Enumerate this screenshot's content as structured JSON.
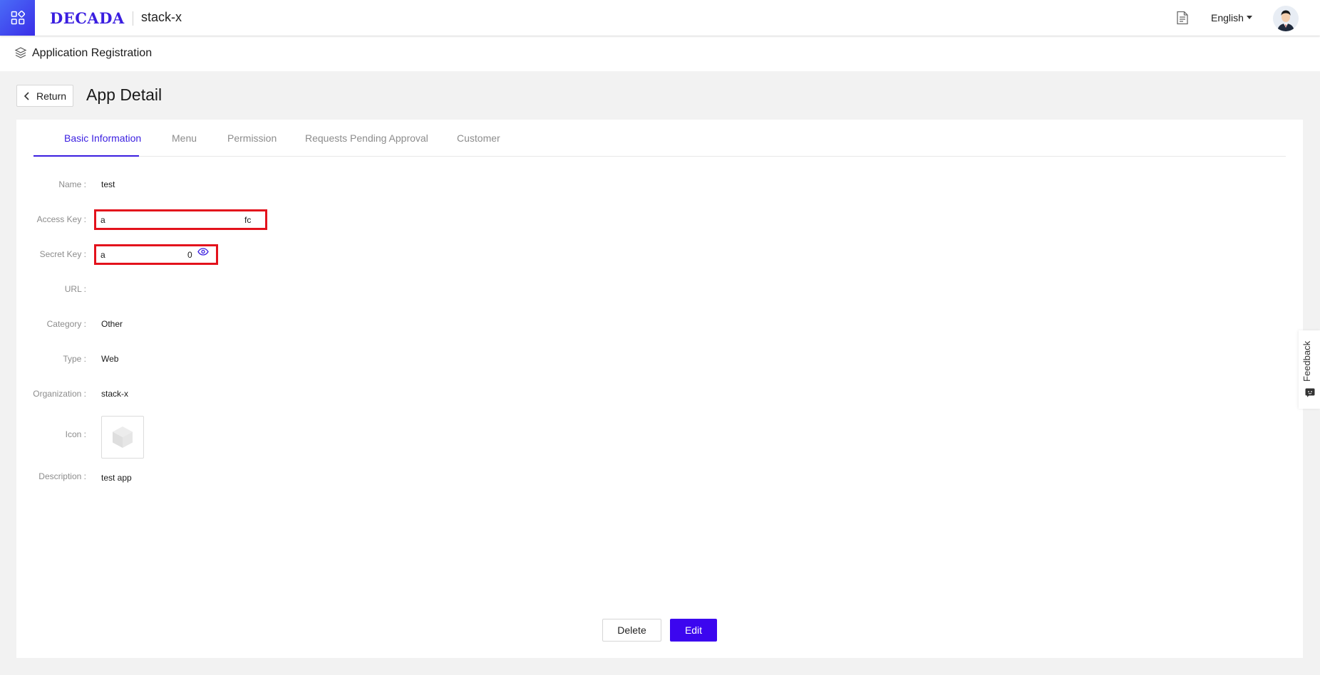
{
  "header": {
    "logo": "DECADA",
    "tenant": "stack-x",
    "language": "English"
  },
  "breadcrumb": {
    "title": "Application Registration"
  },
  "page": {
    "return_label": "Return",
    "title": "App Detail"
  },
  "tabs": [
    {
      "label": "Basic Information",
      "active": true
    },
    {
      "label": "Menu",
      "active": false
    },
    {
      "label": "Permission",
      "active": false
    },
    {
      "label": "Requests Pending Approval",
      "active": false
    },
    {
      "label": "Customer",
      "active": false
    }
  ],
  "fields": {
    "name": {
      "label": "Name",
      "value": "test"
    },
    "access_key": {
      "label": "Access Key",
      "value_start": "a",
      "value_end": "fc"
    },
    "secret_key": {
      "label": "Secret Key",
      "value_start": "a",
      "value_end": "0"
    },
    "url": {
      "label": "URL",
      "value": ""
    },
    "category": {
      "label": "Category",
      "value": "Other"
    },
    "type": {
      "label": "Type",
      "value": "Web"
    },
    "organization": {
      "label": "Organization",
      "value": "stack-x"
    },
    "icon": {
      "label": "Icon"
    },
    "description": {
      "label": "Description",
      "value": "test app"
    }
  },
  "actions": {
    "delete_label": "Delete",
    "edit_label": "Edit"
  },
  "feedback": {
    "label": "Feedback"
  },
  "colors": {
    "primary": "#3c06ef",
    "tab_active": "#3a1ee0",
    "highlight_border": "#e3121c"
  },
  "icons": {
    "app_switch": "grid-icon",
    "docs": "document-icon",
    "breadcrumb": "layers-icon",
    "return": "chevron-left-icon",
    "secret_reveal": "eye-icon",
    "app_icon": "cube-icon",
    "feedback": "chat-icon"
  }
}
